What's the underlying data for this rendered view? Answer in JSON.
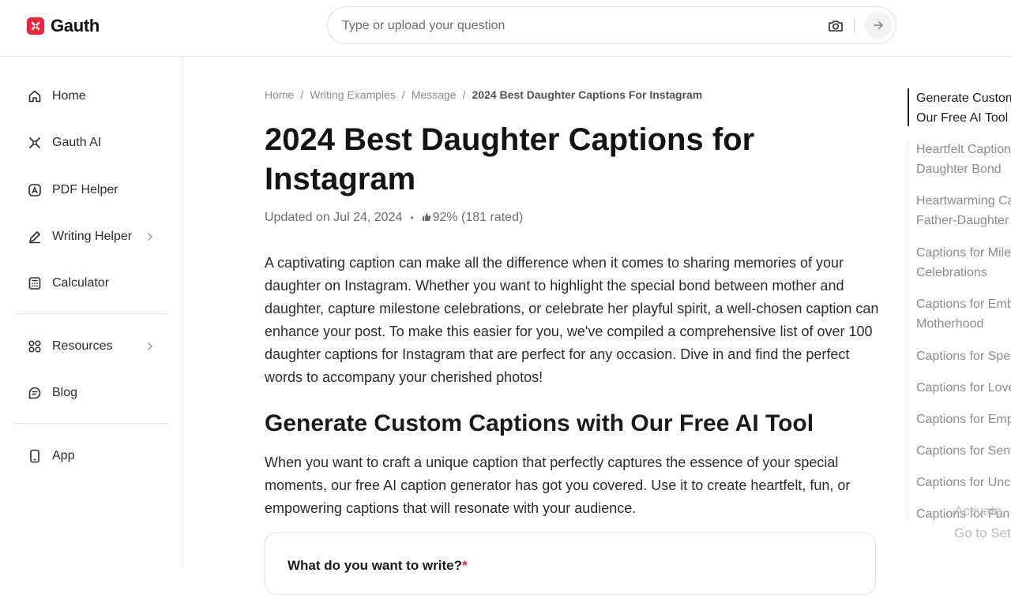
{
  "brand": {
    "name": "Gauth",
    "accent": "#ef233c"
  },
  "search": {
    "placeholder": "Type or upload your question"
  },
  "sidebar": {
    "items": [
      {
        "label": "Home",
        "icon": "home-icon"
      },
      {
        "label": "Gauth AI",
        "icon": "gauth-ai-icon"
      },
      {
        "label": "PDF Helper",
        "icon": "pdf-icon"
      },
      {
        "label": "Writing Helper",
        "icon": "pen-icon"
      },
      {
        "label": "Calculator",
        "icon": "calculator-icon"
      },
      {
        "label": "Resources",
        "icon": "grid-icon"
      },
      {
        "label": "Blog",
        "icon": "blog-icon"
      },
      {
        "label": "App",
        "icon": "phone-icon"
      }
    ]
  },
  "breadcrumb": {
    "items": [
      "Home",
      "Writing Examples",
      "Message"
    ],
    "current": "2024 Best Daughter Captions For Instagram"
  },
  "article": {
    "title": "2024 Best Daughter Captions for Instagram",
    "updated": "Updated on Jul 24, 2024",
    "rating": "92% (181 rated)",
    "intro": "A captivating caption can make all the difference when it comes to sharing memories of your daughter on Instagram. Whether you want to highlight the special bond between mother and daughter, capture milestone celebrations, or celebrate her playful spirit, a well-chosen caption can enhance your post. To make this easier for you, we've compiled a comprehensive list of over 100 daughter captions for Instagram that are perfect for any occasion. Dive in and find the perfect words to accompany your cherished photos!",
    "section_title": "Generate Custom Captions with Our Free AI Tool",
    "section_text": "When you want to craft a unique caption that perfectly captures the essence of your special moments, our free AI caption generator has got you covered. Use it to create heartfelt, fun, or empowering captions that will resonate with your audience.",
    "form_label": "What do you want to write?",
    "form_required": "*"
  },
  "toc": {
    "items": [
      {
        "line1": "Generate Custom Captions with",
        "line2": "Our Free AI Tool"
      },
      {
        "line1": "Heartfelt Captions for",
        "line2": "Daughter Bond"
      },
      {
        "line1": "Heartwarming Captions for",
        "line2": "Father-Daughter"
      },
      {
        "line1": "Captions for Milestone",
        "line2": "Celebrations"
      },
      {
        "line1": "Captions for Embracing",
        "line2": "Motherhood"
      },
      {
        "line1": "Captions for Special"
      },
      {
        "line1": "Captions for Love"
      },
      {
        "line1": "Captions for Empowerment"
      },
      {
        "line1": "Captions for Sentimental"
      },
      {
        "line1": "Captions for Unconditional"
      },
      {
        "line1": "Captions for Fun"
      }
    ]
  },
  "watermark": {
    "line1": "Activate",
    "line2": "Go to Settings"
  }
}
